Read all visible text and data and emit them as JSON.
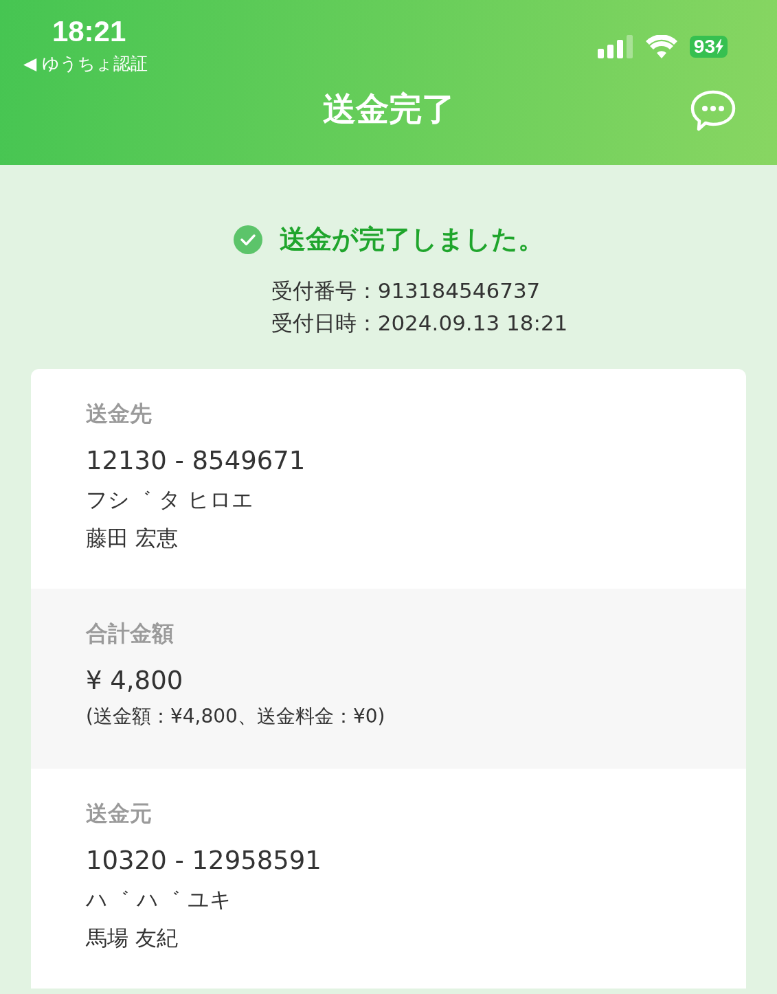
{
  "status_bar": {
    "time": "18:21",
    "back_app": "◀ ゆうちょ認証",
    "battery": "93"
  },
  "nav": {
    "title": "送金完了"
  },
  "result": {
    "message": "送金が完了しました。",
    "lines": [
      "受付番号：913184546737",
      "受付日時：2024.09.13 18:21"
    ]
  },
  "sections": [
    {
      "label": "送金先",
      "shaded": false,
      "lines": [
        {
          "kind": "number",
          "text": "12130 - 8549671"
        },
        {
          "kind": "name",
          "text": "フシ゛ タ ヒロエ"
        },
        {
          "kind": "name",
          "text": "藤田 宏恵"
        }
      ]
    },
    {
      "label": "合計金額",
      "shaded": true,
      "lines": [
        {
          "kind": "amount",
          "text": "¥ 4,800"
        },
        {
          "kind": "note",
          "text": "(送金額：¥4,800、送金料金：¥0)"
        }
      ]
    },
    {
      "label": "送金元",
      "shaded": false,
      "lines": [
        {
          "kind": "number",
          "text": "10320 - 12958591"
        },
        {
          "kind": "name",
          "text": "ハ゛ ハ゛ ユキ"
        },
        {
          "kind": "name",
          "text": "馬場 友紀"
        }
      ]
    }
  ]
}
